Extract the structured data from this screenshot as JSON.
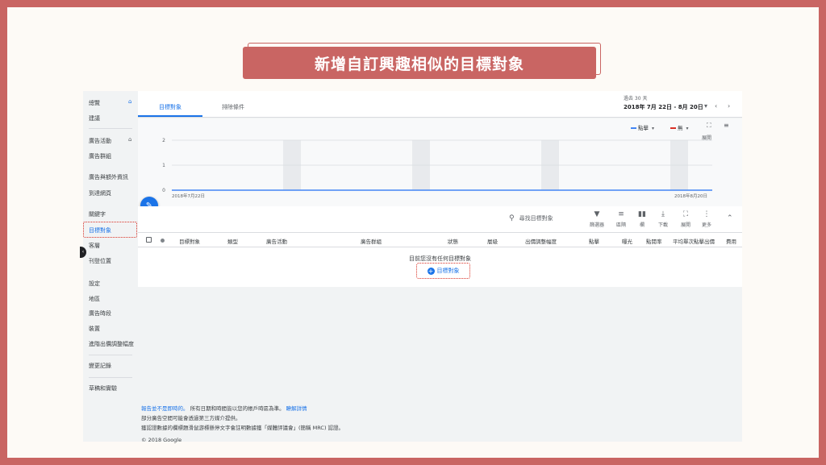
{
  "banner": {
    "title": "新增自訂興趣相似的目標對象"
  },
  "sidebar": {
    "items": [
      {
        "label": "總覽"
      },
      {
        "label": "建議"
      },
      {
        "label": "廣告活動"
      },
      {
        "label": "廣告群組"
      },
      {
        "label": "廣告與額外資訊"
      },
      {
        "label": "到達網頁"
      },
      {
        "label": "關鍵字"
      },
      {
        "label": "目標對象"
      },
      {
        "label": "客層"
      },
      {
        "label": "刊登位置"
      },
      {
        "label": "設定"
      },
      {
        "label": "地區"
      },
      {
        "label": "廣告時段"
      },
      {
        "label": "裝置"
      },
      {
        "label": "進階出價調整幅度"
      },
      {
        "label": "變更記錄"
      },
      {
        "label": "草稿和實驗"
      }
    ],
    "active": "目標對象"
  },
  "tabs": [
    {
      "label": "目標對象"
    },
    {
      "label": "排除條件"
    }
  ],
  "date": {
    "caption": "過去 30 天",
    "range": "2018年 7月 22日 - 8月 20日"
  },
  "chart_controls": {
    "metric1": "點擊",
    "metric2": "無",
    "expand_label": "展開"
  },
  "chart_data": {
    "type": "line",
    "x": [
      "2018年7月22日",
      "2018年8月20日"
    ],
    "series": [
      {
        "values": [
          0,
          0
        ]
      }
    ],
    "yticks": [
      "2",
      "1",
      "0"
    ],
    "ylim": [
      0,
      2
    ],
    "grid": true,
    "colors": {
      "metric1": "#4285f4",
      "metric2": "#d93025"
    }
  },
  "toolbar": {
    "search_placeholder": "尋找目標對象",
    "tools": [
      {
        "icon": "filter-icon",
        "label": "篩選器"
      },
      {
        "icon": "segment-icon",
        "label": "區隔"
      },
      {
        "icon": "columns-icon",
        "label": "欄"
      },
      {
        "icon": "download-icon",
        "label": "下載"
      },
      {
        "icon": "fullscreen-icon",
        "label": "展開"
      },
      {
        "icon": "more-icon",
        "label": "更多"
      }
    ]
  },
  "table": {
    "columns": [
      "目標對象",
      "類型",
      "廣告活動",
      "廣告群組",
      "狀態",
      "層級",
      "出價調整幅度",
      "點擊",
      "曝光",
      "點閱率",
      "平均單次點擊出價",
      "費用"
    ],
    "empty_message": "目前您沒有任何目標對象",
    "add_label": "目標對象"
  },
  "footer": {
    "line1_link": "報告並不是即時的。",
    "line1_text": "所有日期和時間皆以您的帳戶時區為準。",
    "line1_link2": "瞭解詳情",
    "line2": "部分廣告空間可能會透過第三方媒介提供。",
    "line3": "獲認證數據的欄標題滑鼠游標懸停文字會註明數據獲「媒體評議會」(簡稱 MRC) 認證。",
    "copyright": "© 2018 Google"
  }
}
